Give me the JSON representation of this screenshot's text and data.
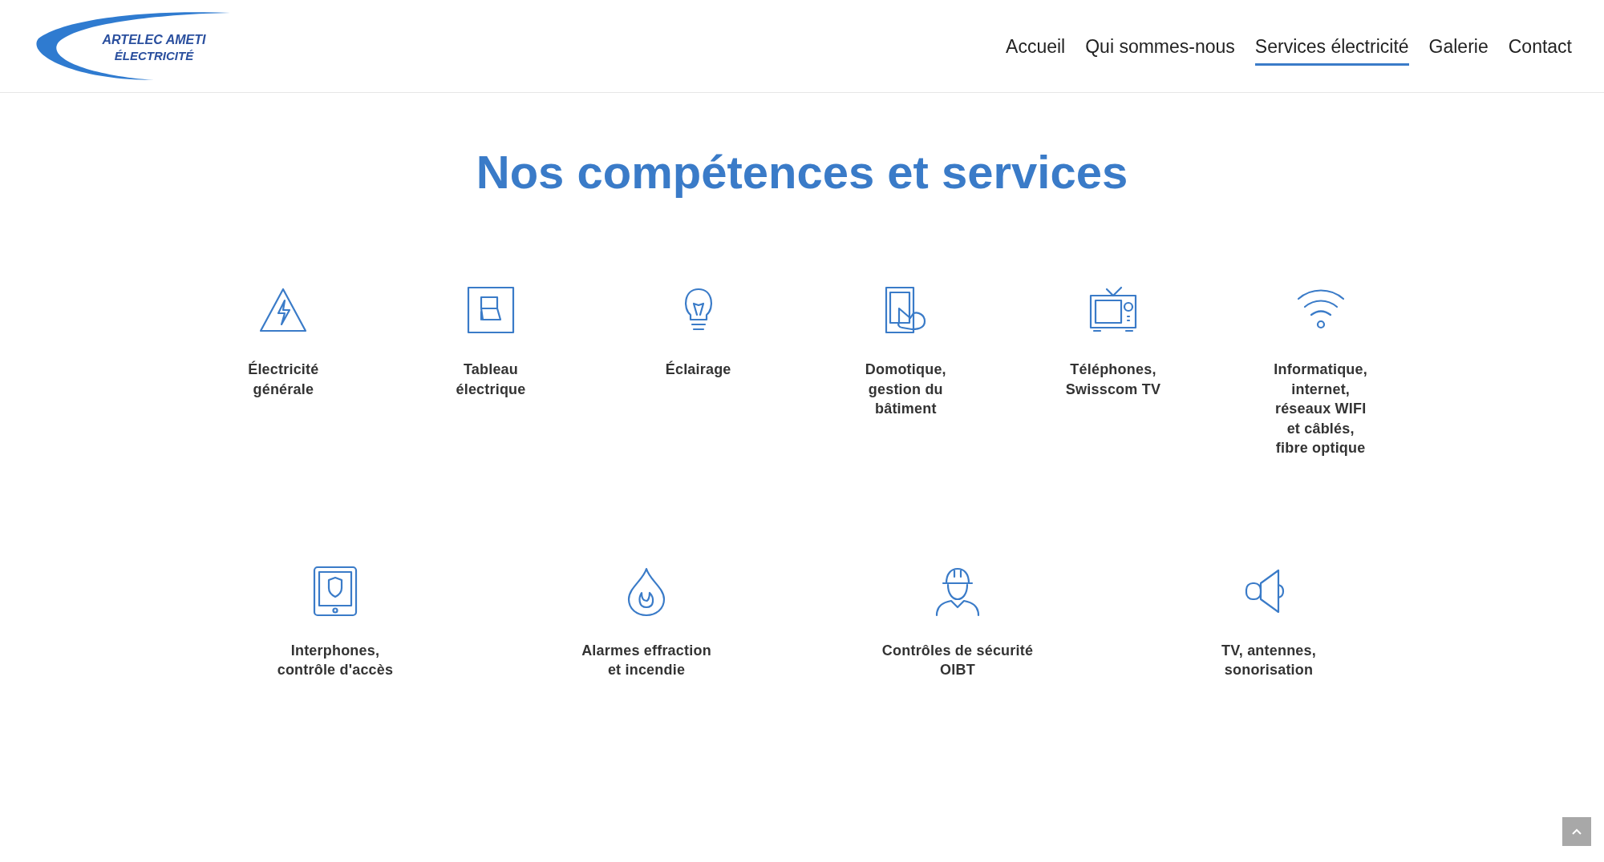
{
  "logo": {
    "line_1": "ARTELEC AMETI",
    "line_2": "ÉLECTRICITÉ"
  },
  "nav": [
    {
      "label": "Accueil",
      "selected": false
    },
    {
      "label": "Qui sommes-nous",
      "selected": false
    },
    {
      "label": "Services électricité",
      "selected": true
    },
    {
      "label": "Galerie",
      "selected": false
    },
    {
      "label": "Contact",
      "selected": false
    }
  ],
  "heading": "Nos compétences et services",
  "services_row_1": [
    {
      "lines": [
        "Électricité",
        "générale"
      ]
    },
    {
      "lines": [
        "Tableau",
        "électrique"
      ]
    },
    {
      "lines": [
        "Éclairage"
      ]
    },
    {
      "lines": [
        "Domotique,",
        "gestion du",
        "bâtiment"
      ]
    },
    {
      "lines": [
        "Téléphones,",
        "Swisscom TV"
      ]
    },
    {
      "lines": [
        "Informatique,",
        "internet,",
        "réseaux WIFI",
        "et câblés,",
        "fibre optique"
      ]
    }
  ],
  "services_row_2": [
    {
      "lines": [
        "Interphones,",
        "contrôle d'accès"
      ]
    },
    {
      "lines": [
        "Alarmes effraction",
        "et incendie"
      ]
    },
    {
      "lines": [
        "Contrôles de sécurité",
        "OIBT"
      ]
    },
    {
      "lines": [
        "TV, antennes,",
        "sonorisation"
      ]
    }
  ]
}
